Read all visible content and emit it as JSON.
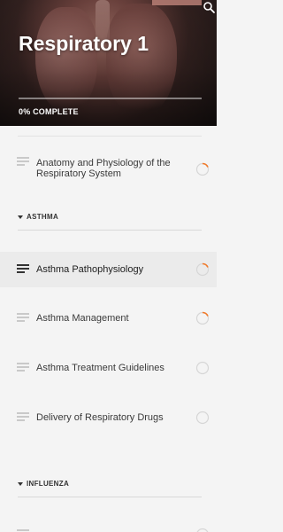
{
  "header": {
    "title": "Respiratory 1",
    "progress_label": "0% COMPLETE",
    "progress_percent": 0,
    "search_icon": "search-icon"
  },
  "sections": [
    {
      "name": "ASTHMA"
    },
    {
      "name": "INFLUENZA"
    }
  ],
  "lessons": [
    {
      "label_line1": "Anatomy and Physiology of the",
      "label_line2": "Respiratory System",
      "status": "in-progress"
    },
    {
      "label": "Asthma Pathophysiology",
      "status": "in-progress",
      "active": true
    },
    {
      "label": "Asthma Management",
      "status": "in-progress"
    },
    {
      "label": "Asthma Treatment Guidelines",
      "status": "not-started"
    },
    {
      "label": "Delivery of Respiratory Drugs",
      "status": "not-started"
    }
  ],
  "colors": {
    "progress_ring": "#f07a2b",
    "ring_track": "#d6d6d6",
    "active_row": "#ebebeb"
  }
}
